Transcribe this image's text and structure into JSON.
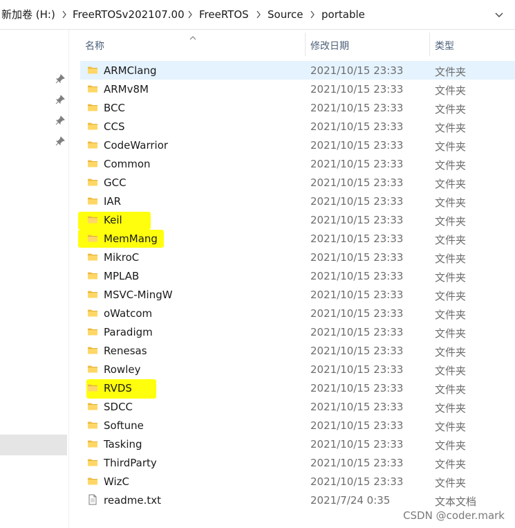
{
  "breadcrumb": {
    "items": [
      "新加卷 (H:)",
      "FreeRTOSv202107.00",
      "FreeRTOS",
      "Source",
      "portable"
    ]
  },
  "icons": {
    "separator": "chevron-right-icon",
    "dropdown": "chevron-down-icon",
    "pin": "pin-icon",
    "folder": "folder-icon",
    "file": "text-file-icon",
    "sort": "sort-ascending-icon"
  },
  "colors": {
    "highlight": "#ffff00",
    "selected_row": "#e5f3ff",
    "folder": "#f2c24f"
  },
  "columns": {
    "name": "名称",
    "date": "修改日期",
    "type": "类型"
  },
  "rows": [
    {
      "name": "ARMClang",
      "date": "2021/10/15 23:33",
      "type": "文件夹",
      "kind": "folder",
      "selected": true,
      "highlighted": false
    },
    {
      "name": "ARMv8M",
      "date": "2021/10/15 23:33",
      "type": "文件夹",
      "kind": "folder",
      "selected": false,
      "highlighted": false
    },
    {
      "name": "BCC",
      "date": "2021/10/15 23:33",
      "type": "文件夹",
      "kind": "folder",
      "selected": false,
      "highlighted": false
    },
    {
      "name": "CCS",
      "date": "2021/10/15 23:33",
      "type": "文件夹",
      "kind": "folder",
      "selected": false,
      "highlighted": false
    },
    {
      "name": "CodeWarrior",
      "date": "2021/10/15 23:33",
      "type": "文件夹",
      "kind": "folder",
      "selected": false,
      "highlighted": false
    },
    {
      "name": "Common",
      "date": "2021/10/15 23:33",
      "type": "文件夹",
      "kind": "folder",
      "selected": false,
      "highlighted": false
    },
    {
      "name": "GCC",
      "date": "2021/10/15 23:33",
      "type": "文件夹",
      "kind": "folder",
      "selected": false,
      "highlighted": false
    },
    {
      "name": "IAR",
      "date": "2021/10/15 23:33",
      "type": "文件夹",
      "kind": "folder",
      "selected": false,
      "highlighted": false
    },
    {
      "name": "Keil",
      "date": "2021/10/15 23:33",
      "type": "文件夹",
      "kind": "folder",
      "selected": false,
      "highlighted": true
    },
    {
      "name": "MemMang",
      "date": "2021/10/15 23:33",
      "type": "文件夹",
      "kind": "folder",
      "selected": false,
      "highlighted": true
    },
    {
      "name": "MikroC",
      "date": "2021/10/15 23:33",
      "type": "文件夹",
      "kind": "folder",
      "selected": false,
      "highlighted": false
    },
    {
      "name": "MPLAB",
      "date": "2021/10/15 23:33",
      "type": "文件夹",
      "kind": "folder",
      "selected": false,
      "highlighted": false
    },
    {
      "name": "MSVC-MingW",
      "date": "2021/10/15 23:33",
      "type": "文件夹",
      "kind": "folder",
      "selected": false,
      "highlighted": false
    },
    {
      "name": "oWatcom",
      "date": "2021/10/15 23:33",
      "type": "文件夹",
      "kind": "folder",
      "selected": false,
      "highlighted": false
    },
    {
      "name": "Paradigm",
      "date": "2021/10/15 23:33",
      "type": "文件夹",
      "kind": "folder",
      "selected": false,
      "highlighted": false
    },
    {
      "name": "Renesas",
      "date": "2021/10/15 23:33",
      "type": "文件夹",
      "kind": "folder",
      "selected": false,
      "highlighted": false
    },
    {
      "name": "Rowley",
      "date": "2021/10/15 23:33",
      "type": "文件夹",
      "kind": "folder",
      "selected": false,
      "highlighted": false
    },
    {
      "name": "RVDS",
      "date": "2021/10/15 23:33",
      "type": "文件夹",
      "kind": "folder",
      "selected": false,
      "highlighted": true
    },
    {
      "name": "SDCC",
      "date": "2021/10/15 23:33",
      "type": "文件夹",
      "kind": "folder",
      "selected": false,
      "highlighted": false
    },
    {
      "name": "Softune",
      "date": "2021/10/15 23:33",
      "type": "文件夹",
      "kind": "folder",
      "selected": false,
      "highlighted": false
    },
    {
      "name": "Tasking",
      "date": "2021/10/15 23:33",
      "type": "文件夹",
      "kind": "folder",
      "selected": false,
      "highlighted": false
    },
    {
      "name": "ThirdParty",
      "date": "2021/10/15 23:33",
      "type": "文件夹",
      "kind": "folder",
      "selected": false,
      "highlighted": false
    },
    {
      "name": "WizC",
      "date": "2021/10/15 23:33",
      "type": "文件夹",
      "kind": "folder",
      "selected": false,
      "highlighted": false
    },
    {
      "name": "readme.txt",
      "date": "2021/7/24 0:35",
      "type": "文本文档",
      "kind": "file",
      "selected": false,
      "highlighted": false
    }
  ],
  "watermark": "CSDN @coder.mark"
}
